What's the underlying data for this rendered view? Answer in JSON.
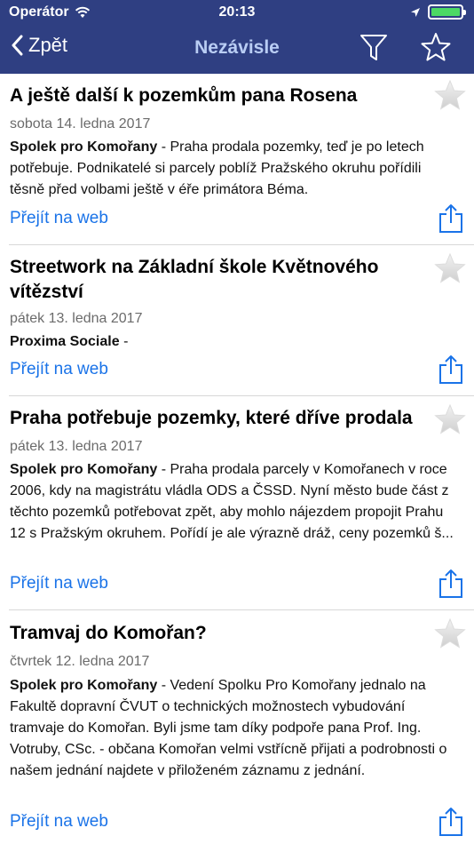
{
  "status": {
    "carrier": "Operátor",
    "time": "20:13"
  },
  "nav": {
    "back_label": "Zpět",
    "title": "Nezávisle"
  },
  "colors": {
    "navbar": "#2f3f82",
    "title": "#b9cdf4",
    "link": "#1a73e8",
    "battery": "#4cd964"
  },
  "articles": [
    {
      "title": "A ještě další k pozemkům pana Rosena",
      "date": "sobota 14. ledna 2017",
      "source": "Spolek pro Komořany",
      "text": " - Praha prodala pozemky, teď je po letech potřebuje. Podnikatelé si parcely poblíž Pražského okruhu pořídili těsně před volbami ještě v éře primátora Béma.",
      "link": "Přejít na web"
    },
    {
      "title": "Streetwork na Základní škole Květnového vítězství",
      "date": "pátek 13. ledna 2017",
      "source": "Proxima Sociale",
      "text": " -",
      "link": "Přejít na web"
    },
    {
      "title": "Praha potřebuje pozemky, které dříve prodala",
      "date": "pátek 13. ledna 2017",
      "source": "Spolek pro Komořany",
      "text": " - Praha prodala parcely v Komořanech v roce 2006, kdy na magistrátu vládla ODS a ČSSD. Nyní město bude část z těchto pozemků potřebovat zpět, aby mohlo nájezdem propojit Prahu 12 s Pražským okruhem. Pořídí je ale výrazně dráž, ceny pozemků š...",
      "link": "Přejít na web"
    },
    {
      "title": "Tramvaj do Komořan?",
      "date": "čtvrtek 12. ledna 2017",
      "source": "Spolek pro Komořany",
      "text": " - Vedení Spolku Pro Komořany jednalo na Fakultě dopravní ČVUT o technických možnostech vybudování tramvaje do Komořan. Byli jsme tam díky podpoře pana Prof. Ing. Votruby, CSc. - občana Komořan velmi vstřícně přijati a podrobnosti o našem jednání najdete v přiloženém záznamu z jednání.",
      "link": "Přejít na web"
    }
  ]
}
